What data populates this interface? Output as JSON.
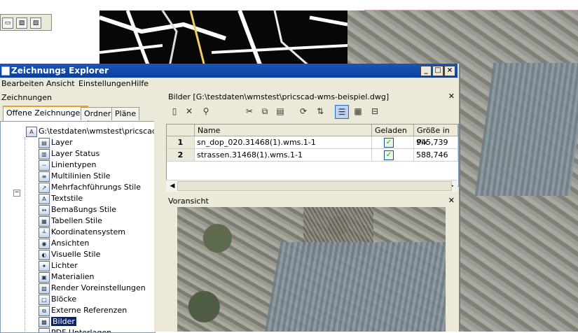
{
  "window": {
    "title": "Zeichnungs Explorer",
    "buttons": {
      "minimize": "_",
      "maximize": "□",
      "close": "×"
    }
  },
  "menu": [
    "Bearbeiten",
    "Ansicht",
    "Einstellungen",
    "Hilfe"
  ],
  "left_panel": {
    "header": "Zeichnungen",
    "tabs": [
      "Offene Zeichnungen",
      "Ordner",
      "Pläne"
    ],
    "active_tab": 0,
    "root_label": "G:\\testdaten\\wmstest\\pricscad-wr",
    "items": [
      {
        "label": "Layer",
        "icon": "layer-icon"
      },
      {
        "label": "Layer Status",
        "icon": "layer-status-icon"
      },
      {
        "label": "Linientypen",
        "icon": "linetype-icon"
      },
      {
        "label": "Multilinien Stile",
        "icon": "multiline-style-icon"
      },
      {
        "label": "Mehrfachführungs Stile",
        "icon": "multileader-style-icon"
      },
      {
        "label": "Textstile",
        "icon": "text-style-icon"
      },
      {
        "label": "Bemaßungs Stile",
        "icon": "dimension-style-icon"
      },
      {
        "label": "Tabellen Stile",
        "icon": "table-style-icon"
      },
      {
        "label": "Koordinatensystem",
        "icon": "coordinate-system-icon"
      },
      {
        "label": "Ansichten",
        "icon": "views-icon"
      },
      {
        "label": "Visuelle Stile",
        "icon": "visual-style-icon"
      },
      {
        "label": "Lichter",
        "icon": "lights-icon"
      },
      {
        "label": "Materialien",
        "icon": "materials-icon"
      },
      {
        "label": "Render Voreinstellungen",
        "icon": "render-presets-icon"
      },
      {
        "label": "Blöcke",
        "icon": "blocks-icon"
      },
      {
        "label": "Externe Referenzen",
        "icon": "xref-icon"
      },
      {
        "label": "Bilder",
        "icon": "images-icon",
        "selected": true
      },
      {
        "label": "PDF Unterlagen",
        "icon": "pdf-icon"
      }
    ]
  },
  "images_panel": {
    "header": "Bilder [G:\\testdaten\\wmstest\\pricscad-wms-beispiel.dwg]",
    "toolbar_icons": [
      "new-image-icon",
      "delete-icon",
      "brush-icon",
      "cut-icon",
      "copy-icon",
      "paste-icon",
      "reload-icon",
      "swap-icon",
      "details-view-icon",
      "tiles-view-icon",
      "tree-view-icon"
    ],
    "columns": [
      "Name",
      "Geladen",
      "Größe in Pix"
    ],
    "rows": [
      {
        "num": "1",
        "name": "sn_dop_020.31468(1).wms.1-1",
        "loaded": true,
        "size": "945,739"
      },
      {
        "num": "2",
        "name": "strassen.31468(1).wms.1-1",
        "loaded": true,
        "size": "588,746"
      }
    ]
  },
  "preview_panel": {
    "header": "Voransicht"
  },
  "colors": {
    "titlebar": "#0a3fa0",
    "selection": "#0a246a",
    "tab_accent": "#e6a12b"
  }
}
